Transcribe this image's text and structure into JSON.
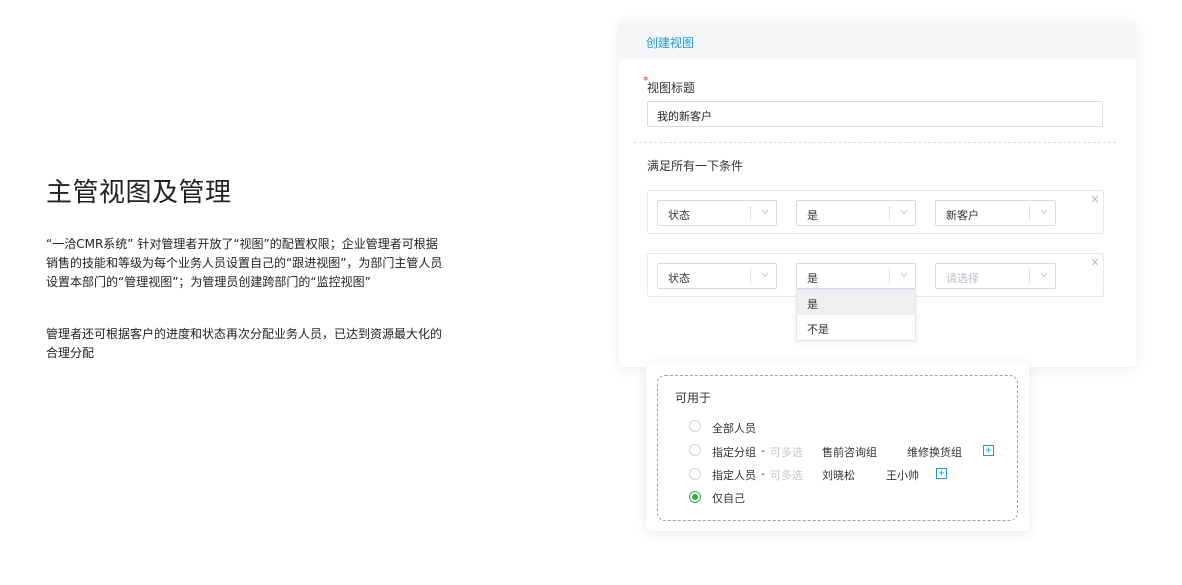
{
  "intro": {
    "heading": "主管视图及管理",
    "paragraph1": "“一洽CMR系统” 针对管理者开放了“视图”的配置权限；企业管理者可根据销售的技能和等级为每个业务人员设置自己的“跟进视图”，为部门主管人员设置本部门的“管理视图”；为管理员创建跨部门的“监控视图”",
    "paragraph2": "管理者还可根据客户的进度和状态再次分配业务人员，已达到资源最大化的合理分配"
  },
  "create_view": {
    "header_title": "创建视图",
    "required_mark": "*",
    "title_label": "视图标题",
    "title_value": "我的新客户",
    "conditions_heading": "满足所有一下条件",
    "close_symbol": "×",
    "conditions": [
      {
        "field": "状态",
        "operator": "是",
        "value": "新客户",
        "value_is_placeholder": false
      },
      {
        "field": "状态",
        "operator": "是",
        "value": "请选择",
        "value_is_placeholder": true
      }
    ],
    "operator_dropdown": {
      "options": [
        "是",
        "不是"
      ],
      "highlighted": "是"
    }
  },
  "availability": {
    "title": "可用于",
    "options": [
      {
        "label": "全部人员",
        "selected": false
      },
      {
        "label": "指定分组",
        "separator": "-",
        "hint": "可多选",
        "tags": [
          "售前咨询组",
          "维修换货组"
        ],
        "add_symbol": "+",
        "selected": false
      },
      {
        "label": "指定人员",
        "separator": "-",
        "hint": "可多选",
        "tags": [
          "刘晓松",
          "王小帅"
        ],
        "add_symbol": "+",
        "selected": false
      },
      {
        "label": "仅自己",
        "selected": true
      }
    ]
  },
  "colors": {
    "accent_blue": "#1f9bd9",
    "radio_green": "#2db34a",
    "required_red": "#e0392b"
  },
  "icons": {
    "select_arrow": "chevron-down-icon",
    "remove_condition": "close-icon",
    "add_item": "plus-icon"
  }
}
